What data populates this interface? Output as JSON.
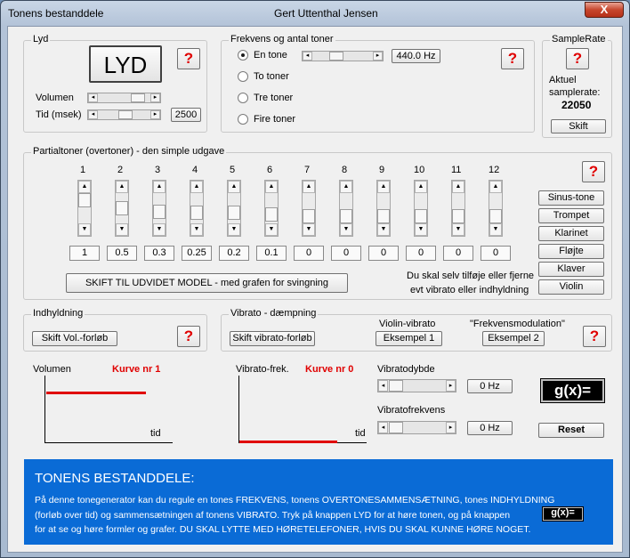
{
  "window": {
    "title": "Tonens bestanddele",
    "author": "Gert Uttenthal Jensen",
    "close_glyph": "X"
  },
  "help_glyph": "?",
  "lyd": {
    "label": "Lyd",
    "button": "LYD",
    "volumen_label": "Volumen",
    "tid_label": "Tid (msek)",
    "tid_value": "2500"
  },
  "frekvens": {
    "label": "Frekvens og antal toner",
    "freq_value": "440.0 Hz",
    "options": [
      "En tone",
      "To toner",
      "Tre toner",
      "Fire toner"
    ],
    "selected": 0
  },
  "samplerate": {
    "label": "SampleRate",
    "aktuel_label": "Aktuel\nsamplerate:",
    "value": "22050",
    "button": "Skift"
  },
  "partial": {
    "label": "Partialtoner (overtoner)  - den simple udgave",
    "numbers": [
      "1",
      "2",
      "3",
      "4",
      "5",
      "6",
      "7",
      "8",
      "9",
      "10",
      "11",
      "12"
    ],
    "values": [
      "1",
      "0.5",
      "0.3",
      "0.25",
      "0.2",
      "0.1",
      "0",
      "0",
      "0",
      "0",
      "0",
      "0"
    ],
    "thumb_levels": [
      0,
      0.5,
      0.7,
      0.75,
      0.8,
      0.9,
      1,
      1,
      1,
      1,
      1,
      1
    ],
    "instruments": [
      "Sinus-tone",
      "Trompet",
      "Klarinet",
      "Fløjte",
      "Klaver",
      "Violin"
    ],
    "model_button": "SKIFT TIL UDVIDET MODEL - med grafen for svingning",
    "hint_line1": "Du skal selv tilføje eller fjerne",
    "hint_line2": "evt vibrato eller indhyldning"
  },
  "indhyldning": {
    "label": "Indhyldning",
    "button": "Skift Vol.-forløb"
  },
  "vibrato": {
    "label": "Vibrato - dæmpning",
    "button": "Skift vibrato-forløb",
    "violin_label": "Violin-vibrato",
    "eksempel1": "Eksempel 1",
    "fm_label": "\"Frekvensmodulation\"",
    "eksempel2": "Eksempel 2"
  },
  "graph1": {
    "ylabel": "Volumen",
    "curve_label": "Kurve nr 1",
    "xlabel": "tid"
  },
  "graph2": {
    "ylabel": "Vibrato-frek.",
    "curve_label": "Kurve nr 0",
    "xlabel": "tid"
  },
  "vib_controls": {
    "dybde_label": "Vibratodybde",
    "dybde_value": "0 Hz",
    "frek_label": "Vibratofrekvens",
    "frek_value": "0 Hz"
  },
  "formula_button": "g(x)=",
  "reset_button": "Reset",
  "info": {
    "title": "TONENS BESTANDDELE:",
    "line1": "På denne tonegenerator kan du regule en tones FREKVENS, tonens OVERTONESAMMENSÆTNING, tones INDHYLDNING",
    "line2": "(forløb over tid) og sammensætningen af tonens VIBRATO. Tryk på knappen LYD for at høre tonen, og på knappen",
    "line3": "for at se og høre formler og grafer. DU SKAL LYTTE MED HØRETELEFONER, HVIS DU SKAL KUNNE HØRE NOGET.",
    "inline_button": "g(x)="
  },
  "colors": {
    "accent_red": "#e00000",
    "info_blue": "#0a6bd6"
  }
}
